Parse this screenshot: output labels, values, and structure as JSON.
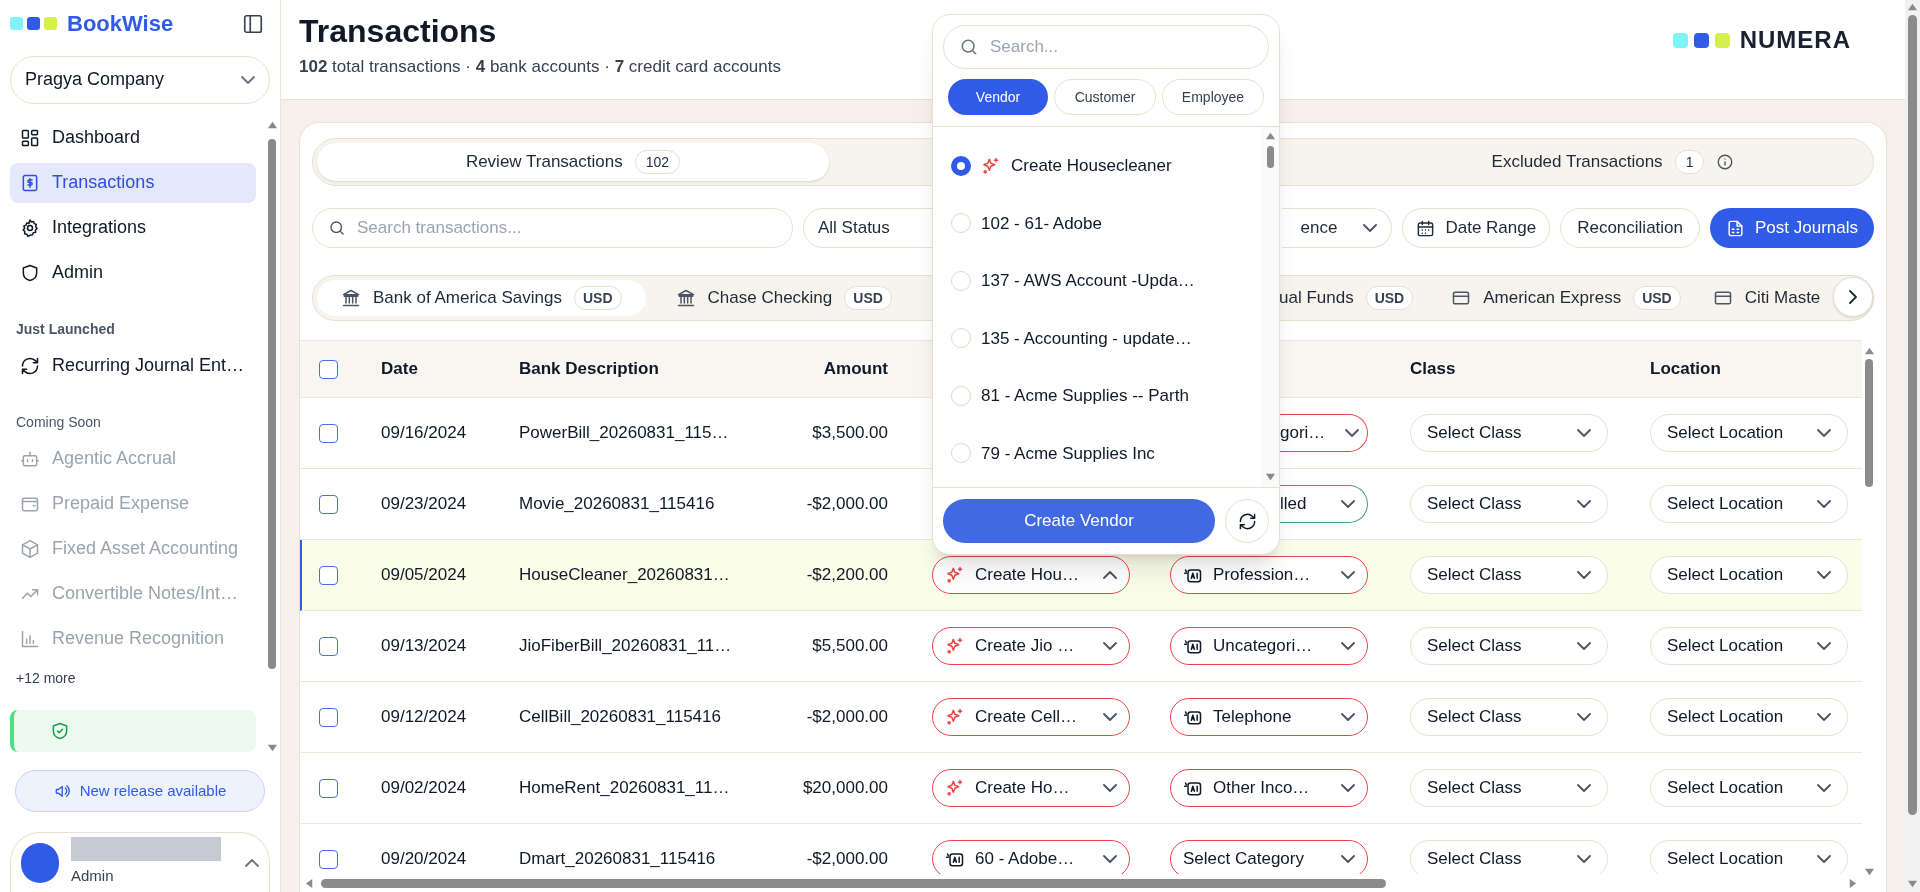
{
  "sidebar": {
    "brand": "BookWise",
    "company": "Pragya Company",
    "items": [
      {
        "kind": "link",
        "label": "Dashboard",
        "selected": false,
        "disabled": false
      },
      {
        "kind": "link",
        "label": "Transactions",
        "selected": true,
        "disabled": false
      },
      {
        "kind": "link",
        "label": "Integrations",
        "selected": false,
        "disabled": false
      },
      {
        "kind": "link",
        "label": "Admin",
        "selected": false,
        "disabled": false
      },
      {
        "kind": "heading",
        "label": "Just Launched"
      },
      {
        "kind": "link",
        "label": "Recurring Journal Ent…",
        "selected": false,
        "disabled": false
      },
      {
        "kind": "subheading",
        "label": "Coming Soon"
      },
      {
        "kind": "link",
        "label": "Agentic Accrual",
        "selected": false,
        "disabled": true
      },
      {
        "kind": "link",
        "label": "Prepaid Expense",
        "selected": false,
        "disabled": true
      },
      {
        "kind": "link",
        "label": "Fixed Asset Accounting",
        "selected": false,
        "disabled": true
      },
      {
        "kind": "link",
        "label": "Convertible Notes/Int…",
        "selected": false,
        "disabled": true
      },
      {
        "kind": "link",
        "label": "Revenue Recognition",
        "selected": false,
        "disabled": true
      },
      {
        "kind": "more",
        "label": "+12 more"
      }
    ],
    "release_button": "New release available",
    "user": {
      "role": "Admin"
    }
  },
  "header": {
    "title": "Transactions",
    "subtitle": "**102** total transactions · **4** bank accounts · **7** credit card accounts",
    "logo": "NUMERA"
  },
  "tabs": [
    {
      "label": "Review Transactions",
      "count": "102",
      "selected": true,
      "info": false
    },
    {
      "label": "Excluded Transactions",
      "count": "1",
      "selected": false,
      "info": true
    }
  ],
  "filters": {
    "search_placeholder": "Search transactions...",
    "controls": [
      {
        "kind": "select",
        "label": "All Status"
      },
      {
        "kind": "select",
        "label": "ence"
      },
      {
        "kind": "date",
        "label": "Date Range"
      },
      {
        "kind": "button",
        "label": "Reconciliation"
      },
      {
        "kind": "primary",
        "label": "Post Journals"
      }
    ]
  },
  "accounts": [
    {
      "kind": "bank",
      "name": "Bank of America Savings",
      "currency": "USD",
      "selected": true
    },
    {
      "kind": "bank",
      "name": "Chase Checking",
      "currency": "USD",
      "selected": false
    },
    {
      "kind": "partial",
      "name": "ual Funds",
      "currency": "USD",
      "selected": false
    },
    {
      "kind": "card",
      "name": "American Express",
      "currency": "USD",
      "selected": false
    },
    {
      "kind": "card",
      "name": "Citi Maste",
      "selected": false
    }
  ],
  "table": {
    "all_checked": false,
    "columns": [
      {
        "label": "Date"
      },
      {
        "label": "Bank Description"
      },
      {
        "label": "Amount"
      },
      {
        "label": "Class"
      },
      {
        "label": "Location"
      }
    ],
    "rows": [
      {
        "date": "09/16/2024",
        "description": "PowerBill_20260831_115…",
        "amount": "$3,500.00",
        "category": {
          "kind": "plain",
          "label": "gori…",
          "color": "#ef4444"
        },
        "class": "Select Class",
        "location": "Select Location",
        "selected": false,
        "checked": false
      },
      {
        "date": "09/23/2024",
        "description": "Movie_20260831_115416",
        "amount": "-$2,000.00",
        "category": {
          "kind": "plain",
          "label": "lled",
          "color": "#4a9f6e"
        },
        "class": "Select Class",
        "location": "Select Location",
        "selected": false,
        "checked": false
      },
      {
        "date": "09/05/2024",
        "description": "HouseCleaner_20260831…",
        "amount": "-$2,200.00",
        "payee": {
          "kind": "create",
          "label": "Create Hou…",
          "expanded": true,
          "color": "#ef4444"
        },
        "category": {
          "kind": "ai",
          "label": "Profession…",
          "color": "#ef4444"
        },
        "class": "Select Class",
        "location": "Select Location",
        "selected": true,
        "checked": false
      },
      {
        "date": "09/13/2024",
        "description": "JioFiberBill_20260831_11…",
        "amount": "$5,500.00",
        "payee": {
          "kind": "create",
          "label": "Create Jio …",
          "expanded": false,
          "color": "#ef4444"
        },
        "category": {
          "kind": "ai",
          "label": "Uncategori…",
          "color": "#ef4444"
        },
        "class": "Select Class",
        "location": "Select Location",
        "selected": false,
        "checked": false
      },
      {
        "date": "09/12/2024",
        "description": "CellBill_20260831_115416",
        "amount": "-$2,000.00",
        "payee": {
          "kind": "create",
          "label": "Create Cell…",
          "expanded": false,
          "color": "#ef4444"
        },
        "category": {
          "kind": "ai",
          "label": "Telephone",
          "color": "#ef4444"
        },
        "class": "Select Class",
        "location": "Select Location",
        "selected": false,
        "checked": false
      },
      {
        "date": "09/02/2024",
        "description": "HomeRent_20260831_11…",
        "amount": "$20,000.00",
        "payee": {
          "kind": "create",
          "label": "Create Ho…",
          "expanded": false,
          "color": "#ef4444"
        },
        "category": {
          "kind": "ai",
          "label": "Other Inco…",
          "color": "#ef4444"
        },
        "class": "Select Class",
        "location": "Select Location",
        "selected": false,
        "checked": false
      },
      {
        "date": "09/20/2024",
        "description": "Dmart_20260831_115416",
        "amount": "-$2,000.00",
        "payee": {
          "kind": "ai",
          "label": "60 - Adobe…",
          "expanded": false,
          "color": "#ef4444"
        },
        "category": {
          "kind": "plain",
          "label": "Select Category",
          "color": "#ef4444"
        },
        "class": "Select Class",
        "location": "Select Location",
        "selected": false,
        "checked": false
      }
    ]
  },
  "popup": {
    "search_placeholder": "Search...",
    "tabs": [
      {
        "label": "Vendor",
        "selected": true
      },
      {
        "label": "Customer",
        "selected": false
      },
      {
        "label": "Employee",
        "selected": false
      }
    ],
    "options": [
      {
        "kind": "create",
        "label": "Create Housecleaner",
        "selected": true
      },
      {
        "kind": "entry",
        "label": "102 - 61- Adobe",
        "selected": false
      },
      {
        "kind": "entry",
        "label": "137 - AWS Account -Upda…",
        "selected": false
      },
      {
        "kind": "entry",
        "label": "135 - Accounting - update…",
        "selected": false
      },
      {
        "kind": "entry",
        "label": "81 - Acme Supplies -- Parth",
        "selected": false
      },
      {
        "kind": "entry",
        "label": "79 - Acme Supplies Inc",
        "selected": false
      }
    ],
    "create_button": "Create Vendor"
  }
}
